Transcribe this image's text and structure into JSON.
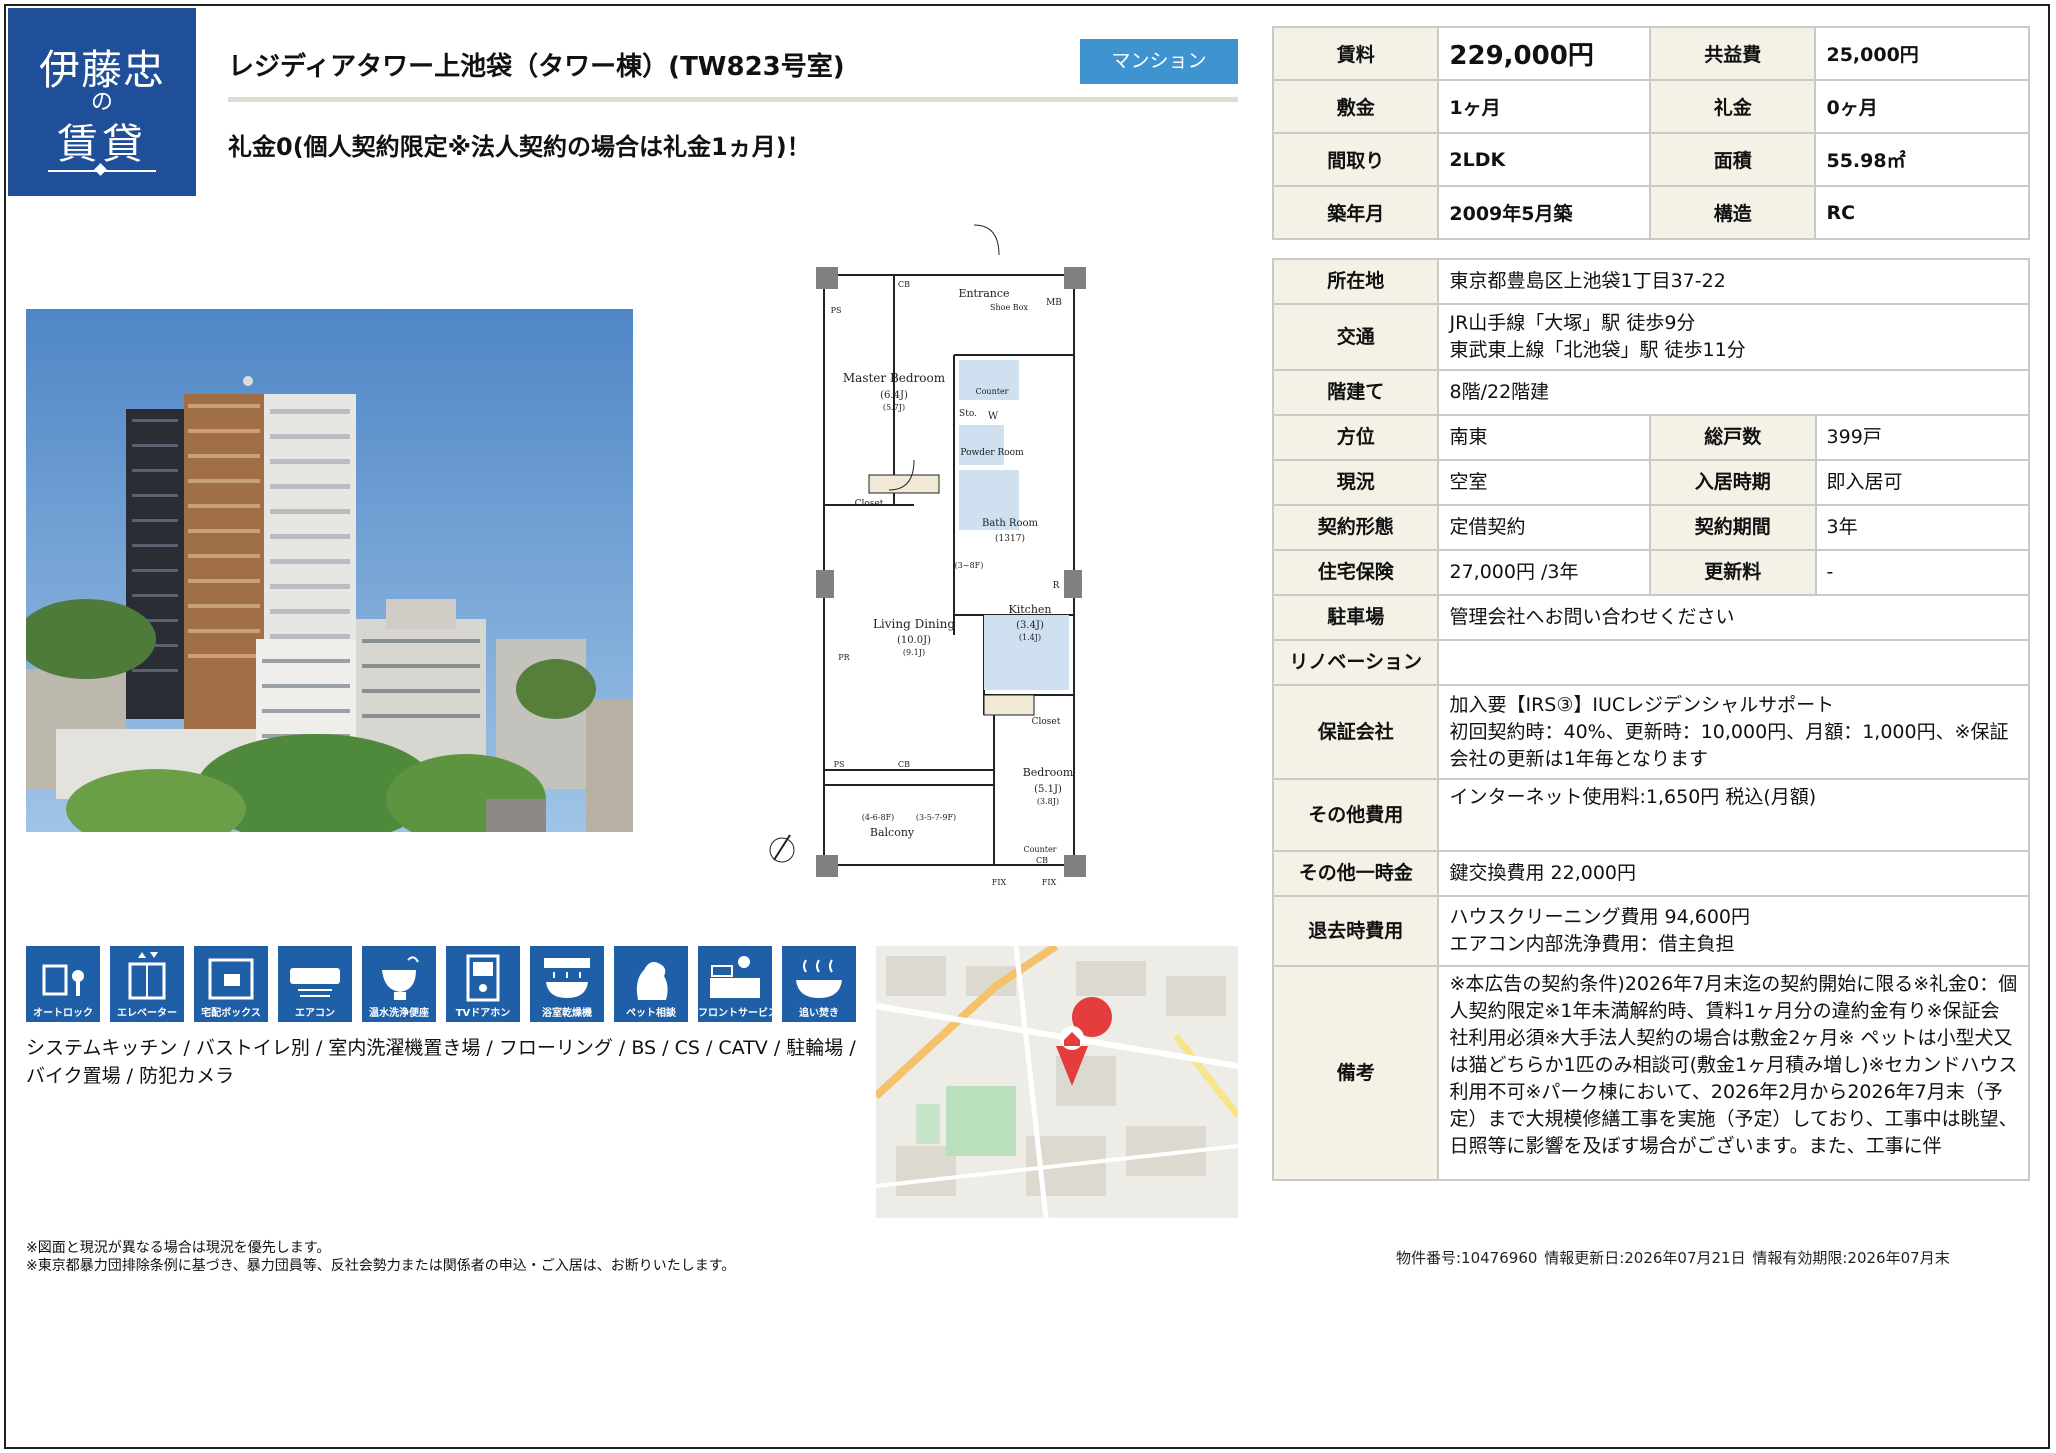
{
  "logo": {
    "line1": "伊藤忠",
    "line2": "の",
    "line3": "賃貸"
  },
  "header": {
    "title": "レジディアタワー上池袋（タワー棟）(TW823号室)",
    "type_badge": "マンション",
    "catch_copy": "礼金0(個人契約限定※法人契約の場合は礼金1ヵ月)！"
  },
  "floorplan": {
    "labels": [
      "Entrance",
      "Shoe Box",
      "MB",
      "PS",
      "CB",
      "Master Bedroom",
      "(6.4J)",
      "(5.7J)",
      "Counter",
      "Sto.",
      "W",
      "Powder Room",
      "Closet",
      "Bath Room",
      "(1317)",
      "(3~8F)",
      "R",
      "Kitchen",
      "(3.4J)",
      "(1.4J)",
      "Living Dining",
      "(10.0J)",
      "(9.1J)",
      "PR",
      "Bedroom",
      "(5.1J)",
      "(3.8J)",
      "(4-6-8F)",
      "(3-5-7-9F)",
      "Balcony",
      "FIX"
    ]
  },
  "equipment": [
    {
      "icon": "auto-lock-icon",
      "label": "オートロック"
    },
    {
      "icon": "elevator-icon",
      "label": "エレベーター"
    },
    {
      "icon": "delivery-box-icon",
      "label": "宅配ボックス"
    },
    {
      "icon": "air-conditioner-icon",
      "label": "エアコン"
    },
    {
      "icon": "washlet-toilet-icon",
      "label": "温水洗浄便座"
    },
    {
      "icon": "tv-intercom-icon",
      "label": "TVドアホン"
    },
    {
      "icon": "bathroom-dryer-icon",
      "label": "浴室乾燥機"
    },
    {
      "icon": "pet-icon",
      "label": "ペット相談"
    },
    {
      "icon": "front-service-icon",
      "label": "フロントサービス"
    },
    {
      "icon": "reheat-bath-icon",
      "label": "追い焚き"
    }
  ],
  "features_text": "システムキッチン / バストイレ別 / 室内洗濯機置き場 / フローリング / BS / CS / CATV / 駐輪場 / バイク置場 / 防犯カメラ",
  "map": {
    "pin_icon": "home-pin-icon"
  },
  "notes": [
    "※図面と現況が異なる場合は現況を優先します。",
    "※東京都暴力団排除条例に基づき、暴力団員等、反社会勢力または関係者の申込・ご入居は、お断りいたします。"
  ],
  "footer": {
    "property_no": "物件番号:10476960",
    "updated": "情報更新日:2026年07月21日",
    "valid_until": "情報有効期限:2026年07月末"
  },
  "summary": {
    "rent_label": "賃料",
    "rent": "229,000円",
    "common_fee_label": "共益費",
    "common_fee": "25,000円",
    "deposit_label": "敷金",
    "deposit": "1ヶ月",
    "key_money_label": "礼金",
    "key_money": "0ヶ月",
    "layout_label": "間取り",
    "layout": "2LDK",
    "area_label": "面積",
    "area": "55.98㎡",
    "built_label": "築年月",
    "built": "2009年5月築",
    "structure_label": "構造",
    "structure": "RC"
  },
  "details": {
    "address_label": "所在地",
    "address": "東京都豊島区上池袋1丁目37-22",
    "transport_label": "交通",
    "transport": "JR山手線「大塚」駅 徒歩9分\n東武東上線「北池袋」駅 徒歩11分",
    "floors_label": "階建て",
    "floors": "8階/22階建",
    "direction_label": "方位",
    "direction": "南東",
    "units_label": "総戸数",
    "units": "399戸",
    "status_label": "現況",
    "status": "空室",
    "move_in_label": "入居時期",
    "move_in": "即入居可",
    "contract_type_label": "契約形態",
    "contract_type": "定借契約",
    "contract_period_label": "契約期間",
    "contract_period": "3年",
    "insurance_label": "住宅保険",
    "insurance": "27,000円 /3年",
    "renewal_fee_label": "更新料",
    "renewal_fee": "-",
    "parking_label": "駐車場",
    "parking": "管理会社へお問い合わせください",
    "renovation_label": "リノベーション",
    "renovation": "",
    "guarantor_label": "保証会社",
    "guarantor": "加入要【IRS③】IUCレジデンシャルサポート\n初回契約時：40%、更新時：10,000円、月額：1,000円、※保証会社の更新は1年毎となります",
    "other_fees_label": "その他費用",
    "other_fees": "インターネット使用料:1,650円 税込(月額)",
    "one_time_label": "その他一時金",
    "one_time": "鍵交換費用 22,000円",
    "moveout_label": "退去時費用",
    "moveout": "ハウスクリーニング費用 94,600円\nエアコン内部洗浄費用：借主負担",
    "remarks_label": "備考",
    "remarks": "※本広告の契約条件)2026年7月末迄の契約開始に限る※礼金0：個人契約限定※1年未満解約時、賃料1ヶ月分の違約金有り※保証会社利用必須※大手法人契約の場合は敷金2ヶ月※ ペットは小型犬又は猫どちらか1匹のみ相談可(敷金1ヶ月積み増し)※セカンドハウス利用不可※パーク棟において、2026年2月から2026年7月末（予定）まで大規模修繕工事を実施（予定）しており、工事中は眺望、日照等に影響を及ぼす場合がございます。また、工事に伴"
  }
}
